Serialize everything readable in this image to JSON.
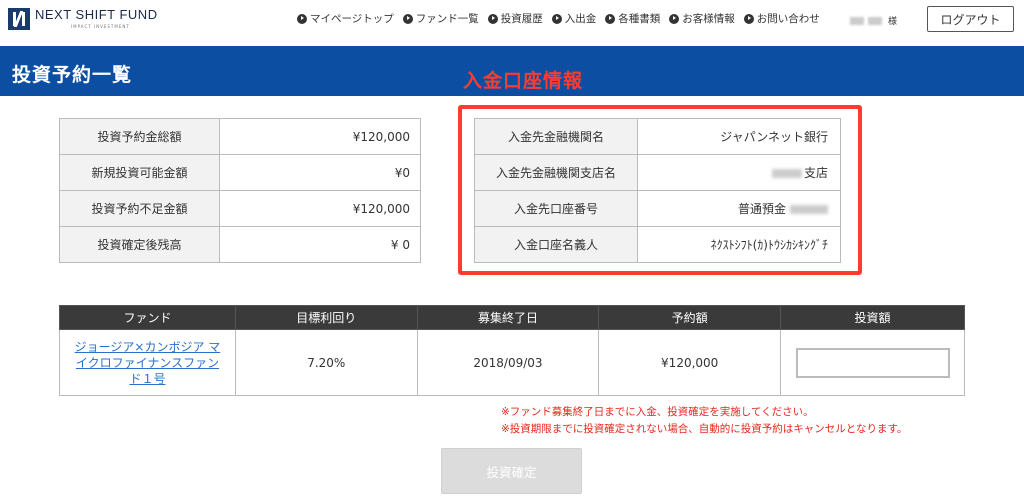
{
  "brand": {
    "name": "NEXT SHIFT FUND",
    "sub": "IMPACT INVESTMENT"
  },
  "nav": [
    {
      "label": "マイページトップ",
      "icon": "arrow-circle-icon"
    },
    {
      "label": "ファンド一覧",
      "icon": "arrow-circle-icon"
    },
    {
      "label": "投資履歴",
      "icon": "arrow-circle-icon"
    },
    {
      "label": "入出金",
      "icon": "arrow-circle-icon"
    },
    {
      "label": "各種書類",
      "icon": "arrow-circle-icon"
    },
    {
      "label": "お客様情報",
      "icon": "arrow-circle-icon"
    },
    {
      "label": "お問い合わせ",
      "icon": "arrow-circle-icon"
    }
  ],
  "user": {
    "suffix": "様"
  },
  "logout_label": "ログアウト",
  "page_title": "投資予約一覧",
  "annotation_label": "入金口座情報",
  "summary": [
    {
      "label": "投資予約金総額",
      "value": "¥120,000"
    },
    {
      "label": "新規投資可能金額",
      "value": "¥0"
    },
    {
      "label": "投資予約不足金額",
      "value": "¥120,000"
    },
    {
      "label": "投資確定後残高",
      "value": "¥ 0"
    }
  ],
  "bank": [
    {
      "label": "入金先金融機関名",
      "value": "ジャパンネット銀行"
    },
    {
      "label": "入金先金融機関支店名",
      "value": "支店"
    },
    {
      "label": "入金先口座番号",
      "value": "普通預金"
    },
    {
      "label": "入金口座名義人",
      "value": "ﾈｸｽﾄｼﾌﾄ(ｶ)ﾄｳｼｶｼｷﾝｸﾞﾁ"
    }
  ],
  "fund_table": {
    "headers": [
      "ファンド",
      "目標利回り",
      "募集終了日",
      "予約額",
      "投資額"
    ],
    "rows": [
      {
        "fund": "ジョージア×カンボジア マイクロファイナンスファンド１号",
        "yield": "7.20%",
        "end_date": "2018/09/03",
        "amount": "¥120,000",
        "invest_value": ""
      }
    ]
  },
  "notes": [
    "※ファンド募集終了日までに入金、投資確定を実施してください。",
    "※投資期限までに投資確定されない場合、自動的に投資予約はキャンセルとなります。"
  ],
  "confirm_label": "投資確定",
  "colors": {
    "brand_blue": "#0b4ea2",
    "annotation_red": "#ff3b30",
    "link_blue": "#2a6fc9",
    "header_dark": "#3a3a3a"
  }
}
